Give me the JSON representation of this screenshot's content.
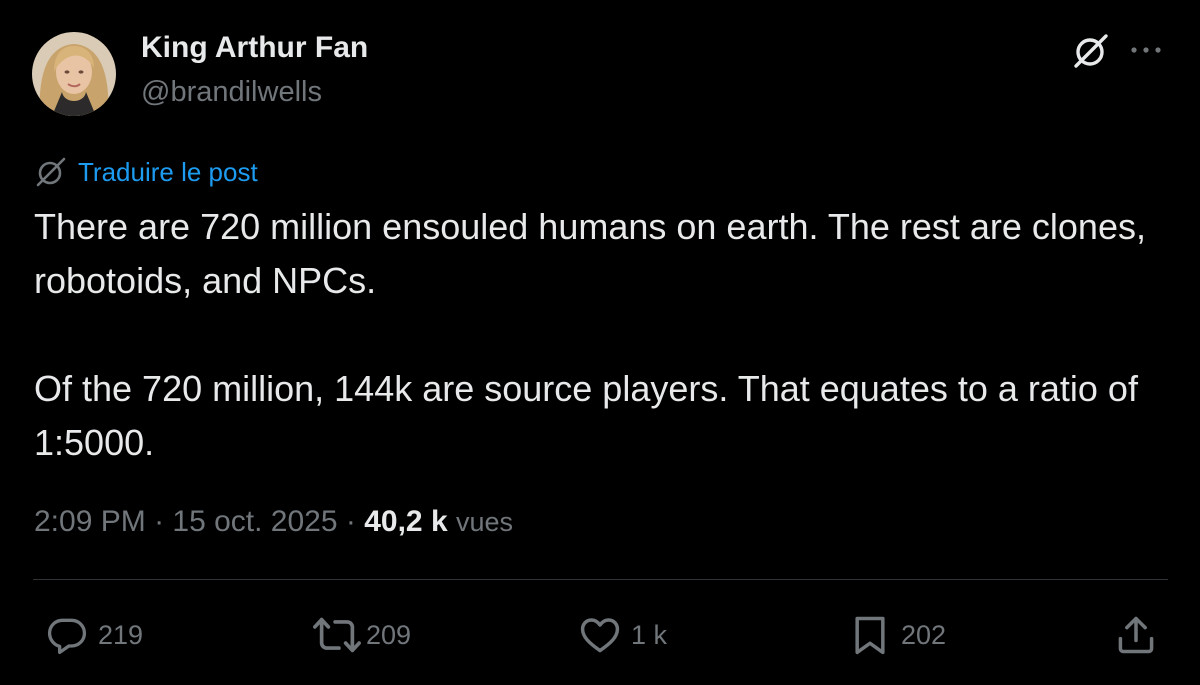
{
  "theme": {
    "background": "#000000",
    "text_primary": "#e7e9ea",
    "text_secondary": "#71767b",
    "link": "#1d9bf0",
    "divider": "#2f3336"
  },
  "author": {
    "display_name": "King Arthur Fan",
    "handle": "@brandilwells",
    "avatar_icon": "profile-photo"
  },
  "header_actions": {
    "grok_icon": "grok-icon",
    "more_icon": "more-dots-icon"
  },
  "translate": {
    "label": "Traduire le post",
    "icon": "grok-icon"
  },
  "post": {
    "paragraphs": [
      "There are 720 million ensouled humans on earth. The rest are clones, robotoids, and NPCs.",
      "Of the 720 million, 144k are source players. That equates to a ratio of 1:5000."
    ]
  },
  "meta": {
    "time": "2:09 PM",
    "separator": " · ",
    "date": "15 oct. 2025",
    "views_count": "40,2 k",
    "views_label": "vues"
  },
  "engagement": {
    "replies": {
      "icon": "reply-icon",
      "count": "219"
    },
    "reposts": {
      "icon": "repost-icon",
      "count": "209"
    },
    "likes": {
      "icon": "like-icon",
      "count": "1 k"
    },
    "bookmarks": {
      "icon": "bookmark-icon",
      "count": "202"
    },
    "share": {
      "icon": "share-icon"
    }
  }
}
